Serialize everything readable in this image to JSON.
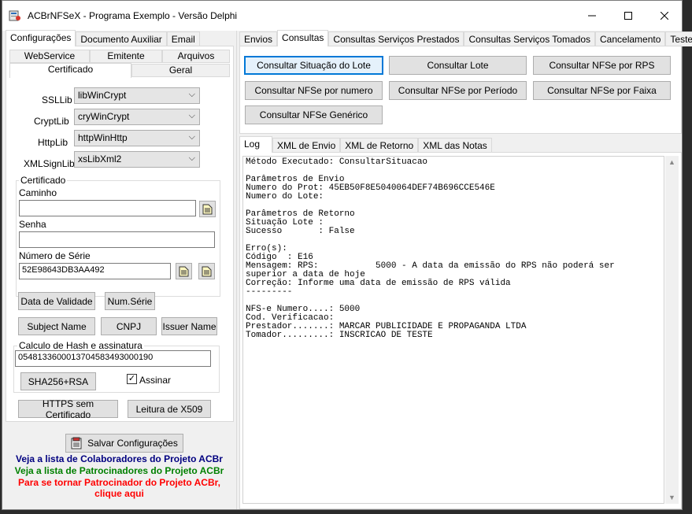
{
  "window": {
    "title": "ACBrNFSeX - Programa Exemplo - Versão Delphi"
  },
  "left_tabs": [
    "Configurações",
    "Documento Auxiliar",
    "Email"
  ],
  "config_subtabs_row1": [
    "WebService",
    "Emitente",
    "Arquivos"
  ],
  "config_subtabs_row2": [
    "Certificado",
    "Geral"
  ],
  "cert": {
    "ssllib_label": "SSLLib",
    "ssllib_value": "libWinCrypt",
    "cryptlib_label": "CryptLib",
    "cryptlib_value": "cryWinCrypt",
    "httplib_label": "HttpLib",
    "httplib_value": "httpWinHttp",
    "xmlsignlib_label": "XMLSignLib",
    "xmlsignlib_value": "xsLibXml2",
    "group_label": "Certificado",
    "caminho_label": "Caminho",
    "caminho_value": "",
    "senha_label": "Senha",
    "senha_value": "",
    "serie_label": "Número de Série",
    "serie_value": "52E98643DB3AA492",
    "btn_validade": "Data de Validade",
    "btn_numserie": "Num.Série",
    "btn_subject": "Subject Name",
    "btn_cnpj": "CNPJ",
    "btn_issuer": "Issuer Name",
    "hash_group_label": "Calculo de Hash e assinatura",
    "hash_value": "05481336000137045834930001​90",
    "btn_sha": "SHA256+RSA",
    "assinar_label": "Assinar",
    "assinar_checked": true,
    "btn_https": "HTTPS sem Certificado",
    "btn_x509": "Leitura de X509"
  },
  "bottom": {
    "save_label": "Salvar Configurações",
    "link1": "Veja a lista de Colaboradores do Projeto ACBr",
    "link2": "Veja a lista de Patrocinadores do Projeto ACBr",
    "link3a": "Para se tornar Patrocinador do Projeto ACBr,",
    "link3b": "clique aqui",
    "link1_color": "#000080",
    "link2_color": "#008000",
    "link3_color": "#ff0000"
  },
  "right_tabs": [
    "Envios",
    "Consultas",
    "Consultas Serviços Prestados",
    "Consultas Serviços Tomados",
    "Cancelamento",
    "Teste"
  ],
  "consultas_buttons": [
    "Consultar Situação do Lote",
    "Consultar Lote",
    "Consultar NFSe por RPS",
    "Consultar NFSe por numero",
    "Consultar NFSe por Período",
    "Consultar NFSe por Faixa",
    "Consultar NFSe Genérico"
  ],
  "log_tabs": [
    "Log",
    "XML de Envio",
    "XML de Retorno",
    "XML das Notas"
  ],
  "log_lines": [
    "Método Executado: ConsultarSituacao",
    "",
    "Parâmetros de Envio",
    "Numero do Prot: 45EB50F8E5040064DEF74B696CCE546E",
    "Numero do Lote:",
    "",
    "Parâmetros de Retorno",
    "Situação Lote :",
    "Sucesso       : False",
    "",
    "Erro(s):",
    "Código  : E16",
    "Mensagem: RPS:           5000 - A data da emissão do RPS não poderá ser",
    "superior a data de hoje",
    "Correção: Informe uma data de emissão de RPS válida",
    "---------",
    "",
    "NFS-e Numero....: 5000",
    "Cod. Verificacao:",
    "Prestador.......: MARCAR PUBLICIDADE E PROPAGANDA LTDA",
    "Tomador.........: INSCRICAO DE TESTE"
  ]
}
